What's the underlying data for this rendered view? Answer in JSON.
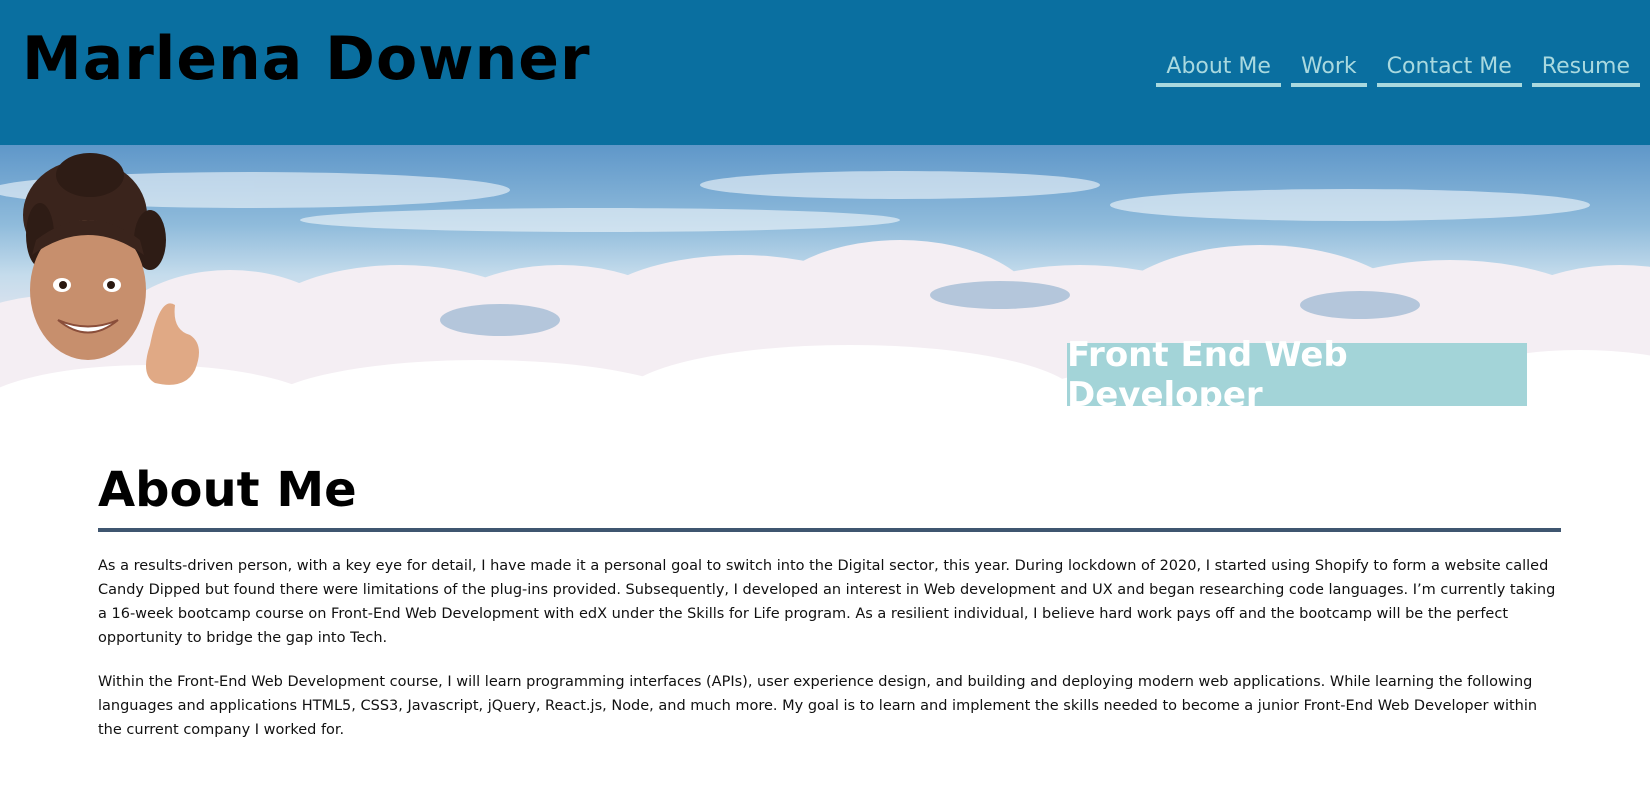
{
  "header": {
    "title": "Marlena Downer",
    "nav": [
      {
        "label": "About Me"
      },
      {
        "label": "Work"
      },
      {
        "label": "Contact Me"
      },
      {
        "label": "Resume"
      }
    ]
  },
  "hero": {
    "tagline": "Front End Web Developer",
    "avatar_icon": "memoji-thumbs-up-avatar"
  },
  "about": {
    "title": "About Me",
    "paragraphs": [
      "As a results-driven person, with a key eye for detail, I have made it a personal goal to switch into the Digital sector, this year. During lockdown of 2020, I started using Shopify to form a website called Candy Dipped but found there were limitations of the plug-ins provided. Subsequently, I developed an interest in Web development and UX and began researching code languages. I’m currently taking a 16-week bootcamp course on Front-End Web Development with edX under the Skills for Life program. As a resilient individual, I believe hard work pays off and the bootcamp will be the perfect opportunity to bridge the gap into Tech.",
      "Within the Front-End Web Development course, I will learn programming interfaces (APIs), user experience design, and building and deploying modern web applications. While learning the following languages and applications HTML5, CSS3, Javascript, jQuery, React.js, Node, and much more. My goal is to learn and implement the skills needed to become a junior Front-End Web Developer within the current company I worked for."
    ]
  },
  "colors": {
    "header_bg": "#0a6fa0",
    "nav_link": "#a9d9df",
    "tagline_bg": "#a3d4d8",
    "rule": "#3f5670"
  }
}
